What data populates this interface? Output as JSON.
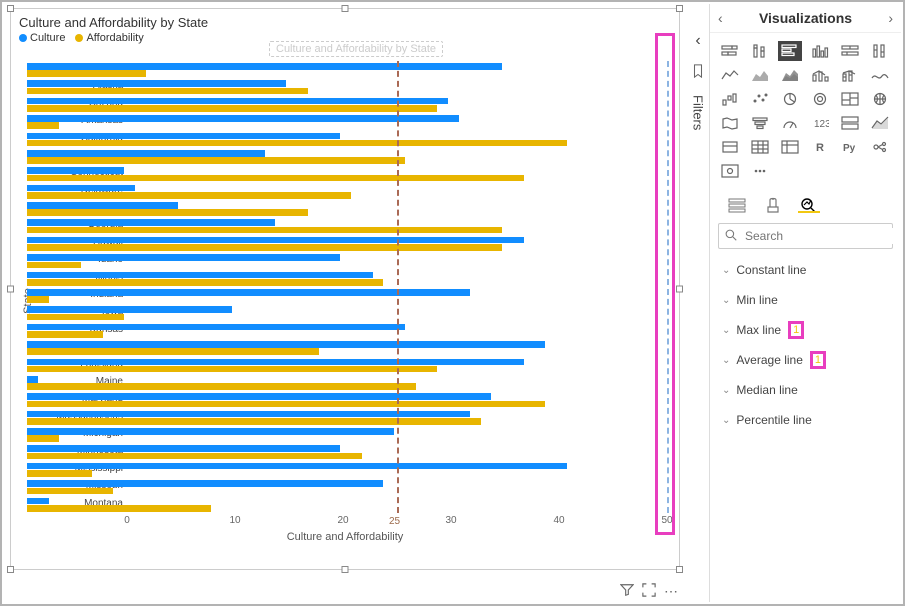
{
  "chart": {
    "title": "Culture and Affordability by State",
    "drag_hint": "Culture and Affordability by State",
    "legend": [
      {
        "label": "Culture",
        "color": "#118DFF"
      },
      {
        "label": "Affordability",
        "color": "#E8B500"
      }
    ],
    "y_axis_title": "State",
    "x_axis_title": "Culture and Affordability",
    "xlim": [
      0,
      50
    ],
    "ticks": [
      0,
      10,
      20,
      30,
      40,
      50
    ],
    "avg_line": {
      "value": 25,
      "label": "25",
      "color": "#AA6A55"
    },
    "max_line": {
      "value": 50,
      "color": "#8CB4E2"
    }
  },
  "chart_data": {
    "type": "bar",
    "orientation": "horizontal",
    "categories": [
      "Alabama",
      "Alaska",
      "Arizona",
      "Arkansas",
      "California",
      "Colorado",
      "Connecticut",
      "Delaware",
      "Florida",
      "Georgia",
      "Hawaii",
      "Idaho",
      "Illinois",
      "Indiana",
      "Iowa",
      "Kansas",
      "Kentucky",
      "Louisiana",
      "Maine",
      "Maryland",
      "Massachusetts",
      "Michigan",
      "Minnesota",
      "Mississippi",
      "Missouri",
      "Montana"
    ],
    "series": [
      {
        "name": "Culture",
        "color": "#118DFF",
        "values": [
          44,
          24,
          39,
          40,
          29,
          22,
          9,
          10,
          14,
          23,
          46,
          29,
          32,
          41,
          19,
          35,
          48,
          46,
          1,
          43,
          41,
          34,
          29,
          50,
          33,
          2
        ]
      },
      {
        "name": "Affordability",
        "color": "#E8B500",
        "values": [
          11,
          26,
          38,
          3,
          50,
          35,
          46,
          30,
          26,
          44,
          44,
          5,
          33,
          2,
          9,
          7,
          27,
          38,
          36,
          48,
          42,
          3,
          31,
          6,
          8,
          17
        ]
      }
    ],
    "title": "Culture and Affordability by State",
    "xlabel": "Culture and Affordability",
    "ylabel": "State",
    "xlim": [
      0,
      50
    ]
  },
  "filters_pane": {
    "label": "Filters"
  },
  "viz_pane": {
    "title": "Visualizations",
    "search_placeholder": "Search",
    "gallery_icons": [
      "stacked-bar",
      "stacked-column",
      "clustered-bar",
      "clustered-column",
      "100-stacked-bar",
      "100-stacked-column",
      "line",
      "area",
      "stacked-area",
      "line-col",
      "line-col-stacked",
      "ribbon",
      "waterfall",
      "scatter",
      "pie",
      "donut",
      "treemap",
      "map",
      "filled-map",
      "funnel",
      "gauge",
      "card",
      "multi-row-card",
      "kpi",
      "slicer",
      "table",
      "matrix",
      "r",
      "py",
      "key-influencers",
      "arcgis",
      "more"
    ],
    "selected_icon": "clustered-bar",
    "format_tabs": {
      "active": "analytics"
    },
    "analytics": [
      {
        "key": "constant",
        "label": "Constant line",
        "count": null
      },
      {
        "key": "min",
        "label": "Min line",
        "count": null
      },
      {
        "key": "max",
        "label": "Max line",
        "count": "1"
      },
      {
        "key": "average",
        "label": "Average line",
        "count": "1"
      },
      {
        "key": "median",
        "label": "Median line",
        "count": null
      },
      {
        "key": "percentile",
        "label": "Percentile line",
        "count": null
      }
    ]
  }
}
